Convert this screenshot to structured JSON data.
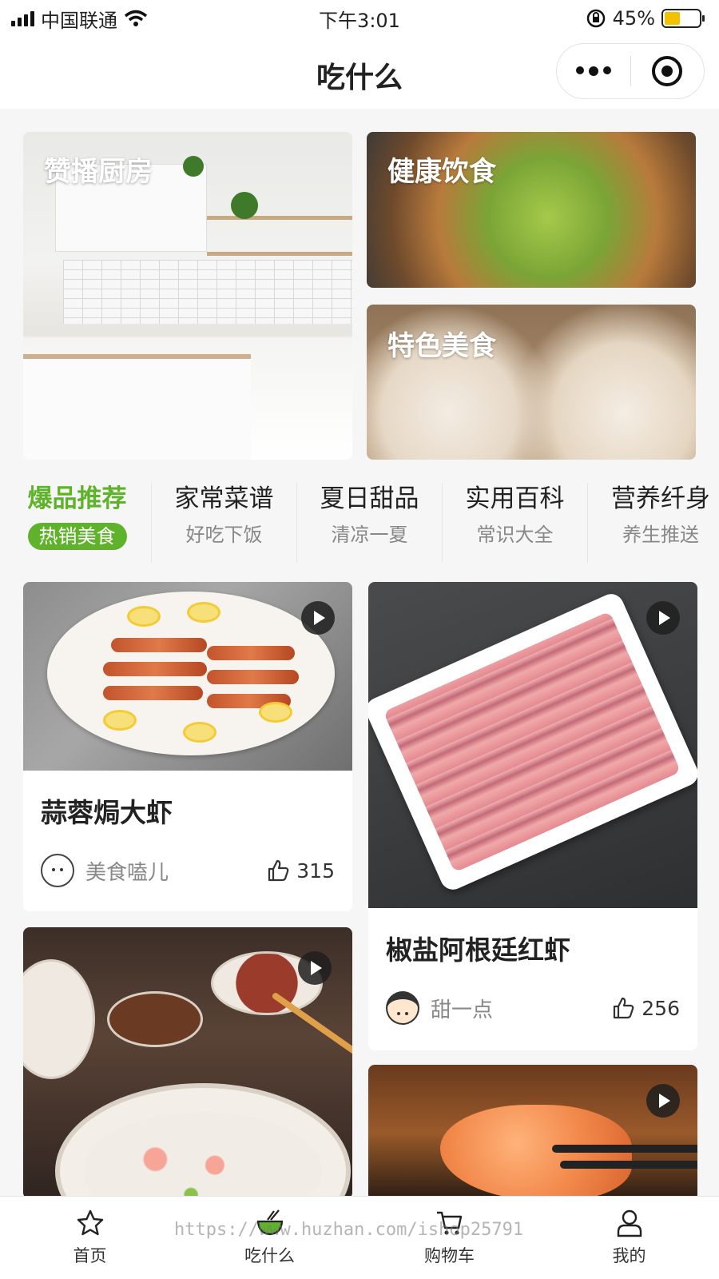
{
  "status": {
    "carrier": "中国联通",
    "time": "下午3:01",
    "battery": "45%",
    "battery_level": 0.45
  },
  "nav": {
    "title": "吃什么"
  },
  "banners": [
    {
      "label": "赞播厨房"
    },
    {
      "label": "健康饮食"
    },
    {
      "label": "特色美食"
    }
  ],
  "tabs": [
    {
      "title": "爆品推荐",
      "sub": "热销美食",
      "active": true
    },
    {
      "title": "家常菜谱",
      "sub": "好吃下饭"
    },
    {
      "title": "夏日甜品",
      "sub": "清凉一夏"
    },
    {
      "title": "实用百科",
      "sub": "常识大全"
    },
    {
      "title": "营养纤身",
      "sub": "养生推送"
    }
  ],
  "cards": [
    {
      "title": "蒜蓉焗大虾",
      "author": "美食嗑儿",
      "likes": "315"
    },
    {
      "title": "椒盐阿根廷红虾",
      "author": "甜一点",
      "likes": "256"
    }
  ],
  "tabbar": [
    {
      "label": "首页",
      "icon": "star-icon"
    },
    {
      "label": "吃什么",
      "icon": "bowl-icon",
      "active": true
    },
    {
      "label": "购物车",
      "icon": "cart-icon"
    },
    {
      "label": "我的",
      "icon": "user-icon"
    }
  ],
  "watermark": "https://www.huzhan.com/ishop25791",
  "colors": {
    "accent": "#5fb32a",
    "battery": "#f2c200"
  }
}
